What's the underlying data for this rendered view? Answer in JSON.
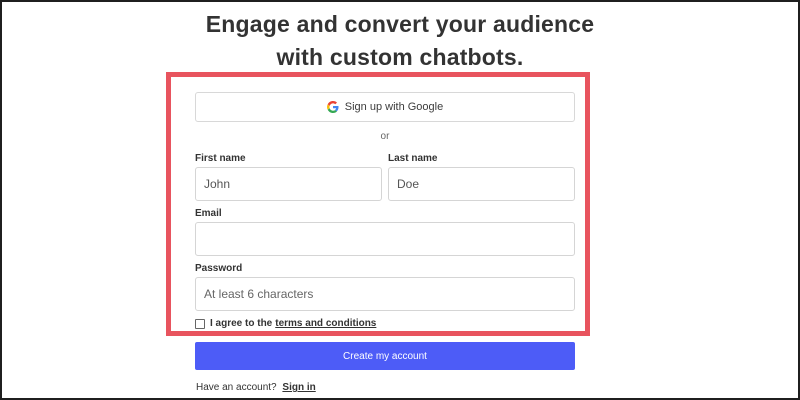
{
  "header": {
    "line1": "Engage and convert your audience",
    "line2": "with custom chatbots."
  },
  "form": {
    "google_button_label": "Sign up with Google",
    "or_separator": "or",
    "first_name": {
      "label": "First name",
      "value": "John"
    },
    "last_name": {
      "label": "Last name",
      "value": "Doe"
    },
    "email": {
      "label": "Email",
      "value": ""
    },
    "password": {
      "label": "Password",
      "placeholder": "At least 6 characters"
    },
    "agree_prefix": "I agree to the",
    "agree_link": "terms and conditions",
    "submit_label": "Create my account"
  },
  "footer": {
    "prompt": "Have an account?",
    "signin_link": "Sign in"
  },
  "colors": {
    "highlight_border": "#e8545e",
    "submit_button": "#4d5cf7"
  },
  "icons": {
    "google": "google-g-icon"
  }
}
